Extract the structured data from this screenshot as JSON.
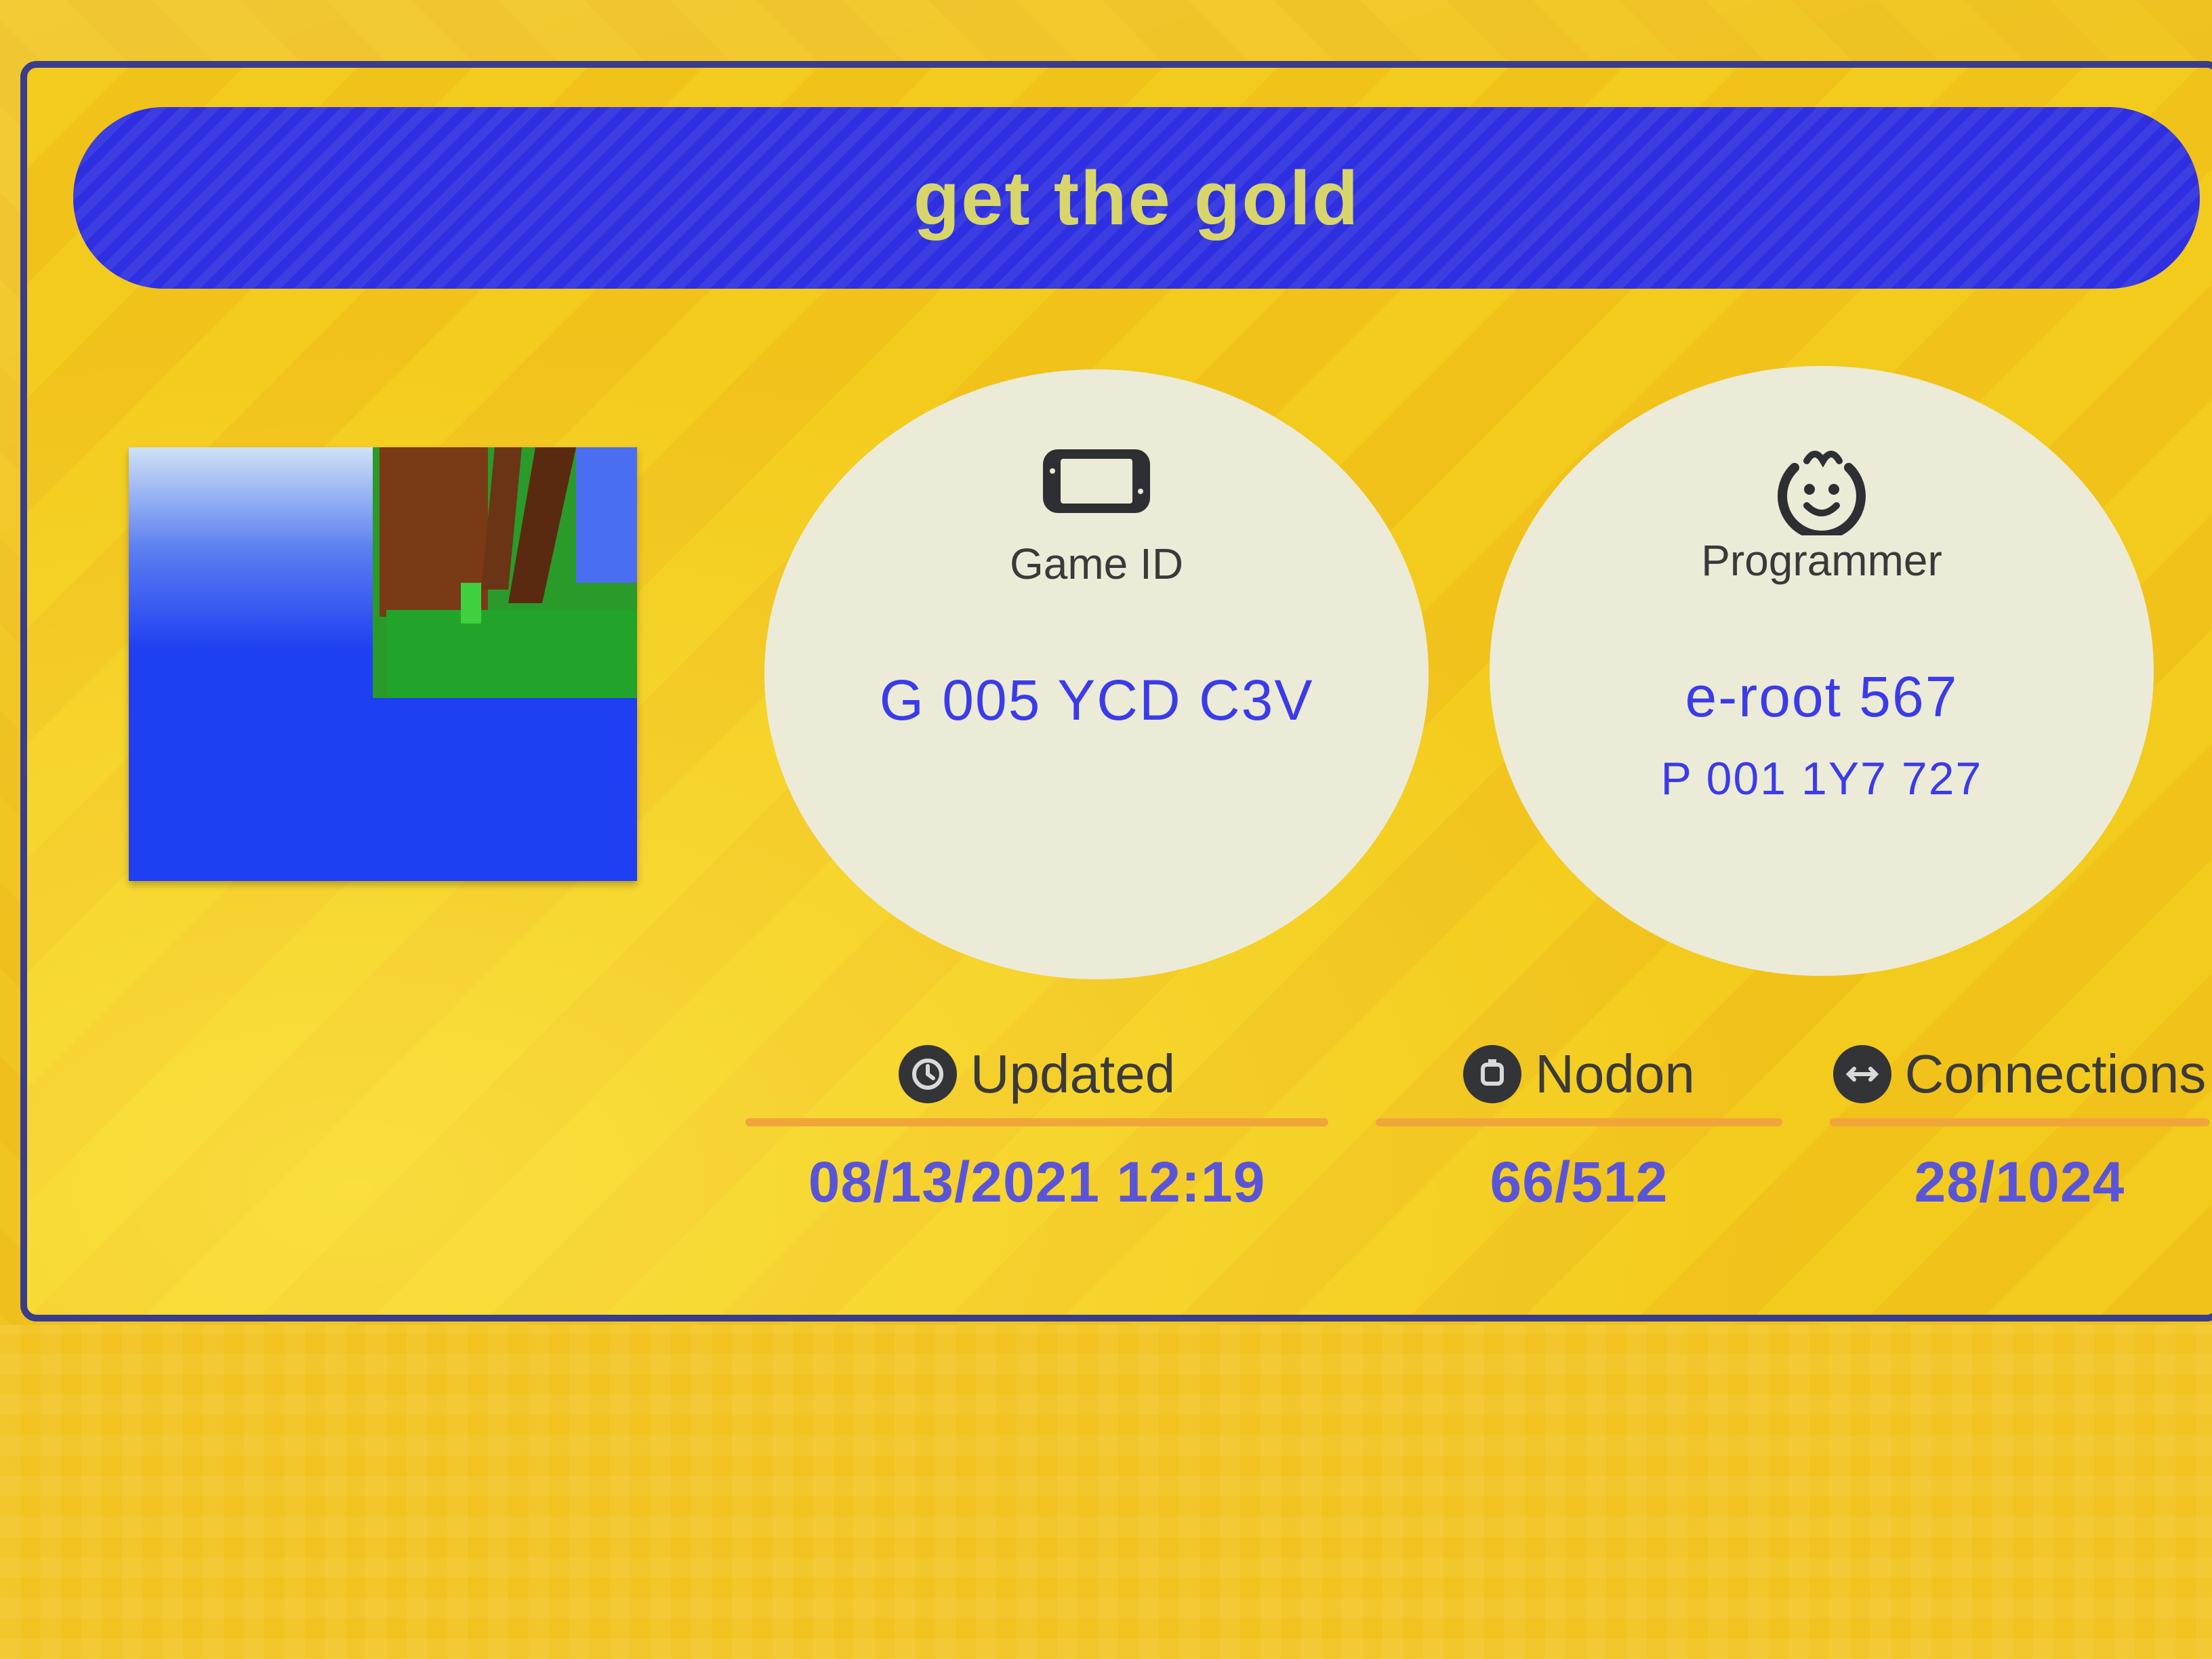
{
  "game": {
    "title": "get the gold"
  },
  "game_id": {
    "icon": "handheld-console-icon",
    "label": "Game ID",
    "value": "G 005 YCD C3V"
  },
  "programmer": {
    "icon": "smiley-face-icon",
    "label": "Programmer",
    "name": "e-root 567",
    "id": "P 001 1Y7 727"
  },
  "stats": {
    "updated": {
      "icon": "clock-icon",
      "label": "Updated",
      "value": "08/13/2021 12:19"
    },
    "nodon": {
      "icon": "nodon-icon",
      "label": "Nodon",
      "value": "66/512"
    },
    "connections": {
      "icon": "connections-icon",
      "label": "Connections",
      "value": "28/1024"
    }
  },
  "colors": {
    "background": "#f1c51f",
    "title_bar": "#2d2fe0",
    "title_text": "#d8d66a",
    "value_text": "#3b3bea",
    "rule": "#f0a53a"
  }
}
